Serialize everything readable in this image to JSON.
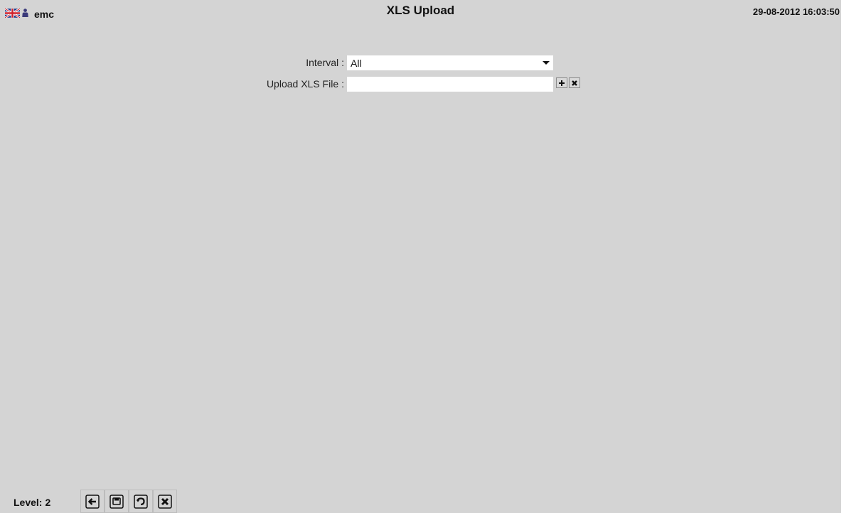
{
  "header": {
    "username": "emc",
    "title": "XLS Upload",
    "datetime": "29-08-2012 16:03:50"
  },
  "form": {
    "interval_label": "Interval",
    "interval_value": "All",
    "upload_label": "Upload XLS File",
    "colon": ":",
    "upload_value": "",
    "add_icon": "plus-icon",
    "clear_icon": "x-icon"
  },
  "footer": {
    "level_label": "Level:",
    "level_value": "2",
    "buttons": [
      "back-arrow-icon",
      "save-icon",
      "undo-icon",
      "x-icon"
    ]
  },
  "colors": {
    "background": "#d4d4d4",
    "flag_blue": "#1a3a8c",
    "flag_red": "#d0202a",
    "user_icon": "#3a3a7a"
  }
}
